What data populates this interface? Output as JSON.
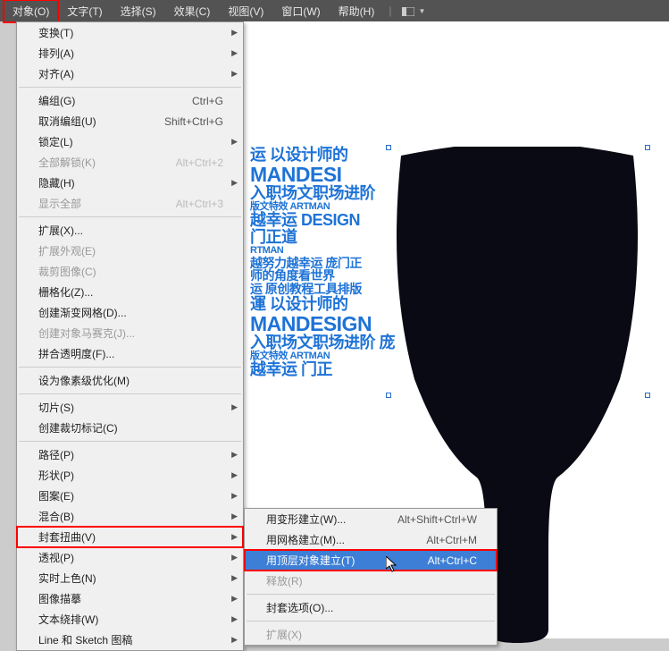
{
  "menubar": {
    "items": [
      "对象(O)",
      "文字(T)",
      "选择(S)",
      "效果(C)",
      "视图(V)",
      "窗口(W)",
      "帮助(H)"
    ],
    "active_index": 0
  },
  "main_menu": [
    {
      "label": "变换(T)",
      "shortcut": "",
      "arrow": true
    },
    {
      "label": "排列(A)",
      "shortcut": "",
      "arrow": true
    },
    {
      "label": "对齐(A)",
      "shortcut": "",
      "arrow": true
    },
    {
      "sep": true
    },
    {
      "label": "编组(G)",
      "shortcut": "Ctrl+G"
    },
    {
      "label": "取消编组(U)",
      "shortcut": "Shift+Ctrl+G"
    },
    {
      "label": "锁定(L)",
      "shortcut": "",
      "arrow": true
    },
    {
      "label": "全部解锁(K)",
      "shortcut": "Alt+Ctrl+2",
      "disabled": true
    },
    {
      "label": "隐藏(H)",
      "shortcut": "",
      "arrow": true
    },
    {
      "label": "显示全部",
      "shortcut": "Alt+Ctrl+3",
      "disabled": true
    },
    {
      "sep": true
    },
    {
      "label": "扩展(X)..."
    },
    {
      "label": "扩展外观(E)",
      "disabled": true
    },
    {
      "label": "裁剪图像(C)",
      "disabled": true
    },
    {
      "label": "栅格化(Z)..."
    },
    {
      "label": "创建渐变网格(D)..."
    },
    {
      "label": "创建对象马赛克(J)...",
      "disabled": true
    },
    {
      "label": "拼合透明度(F)..."
    },
    {
      "sep": true
    },
    {
      "label": "设为像素级优化(M)"
    },
    {
      "sep": true
    },
    {
      "label": "切片(S)",
      "arrow": true
    },
    {
      "label": "创建裁切标记(C)"
    },
    {
      "sep": true
    },
    {
      "label": "路径(P)",
      "arrow": true
    },
    {
      "label": "形状(P)",
      "arrow": true
    },
    {
      "label": "图案(E)",
      "arrow": true
    },
    {
      "label": "混合(B)",
      "arrow": true
    },
    {
      "label": "封套扭曲(V)",
      "arrow": true,
      "highlight": "red"
    },
    {
      "label": "透视(P)",
      "arrow": true
    },
    {
      "label": "实时上色(N)",
      "arrow": true
    },
    {
      "label": "图像描摹",
      "arrow": true
    },
    {
      "label": "文本绕排(W)",
      "arrow": true
    },
    {
      "label": "Line 和 Sketch 图稿",
      "arrow": true
    }
  ],
  "sub_menu": [
    {
      "label": "用变形建立(W)...",
      "shortcut": "Alt+Shift+Ctrl+W"
    },
    {
      "label": "用网格建立(M)...",
      "shortcut": "Alt+Ctrl+M"
    },
    {
      "label": "用顶层对象建立(T)",
      "shortcut": "Alt+Ctrl+C",
      "highlight": "blue"
    },
    {
      "label": "释放(R)",
      "disabled": true
    },
    {
      "sep": true
    },
    {
      "label": "封套选项(O)..."
    },
    {
      "sep": true
    },
    {
      "label": "扩展(X)",
      "disabled": true
    }
  ],
  "canvas": {
    "lines": [
      {
        "cls": "med",
        "text": "运 以设计师的"
      },
      {
        "cls": "big",
        "text": "MANDESI"
      },
      {
        "cls": "med",
        "text": "入职场文职场进阶"
      },
      {
        "cls": "xs",
        "text": "版文特效 ARTMAN"
      },
      {
        "cls": "med",
        "text": "越幸运 DESIGN"
      },
      {
        "cls": "med",
        "text": "门正道"
      },
      {
        "cls": "xs",
        "text": "RTMAN"
      },
      {
        "cls": "sm",
        "text": "越努力越幸运 庞门正"
      },
      {
        "cls": "sm",
        "text": "师的角度看世界"
      },
      {
        "cls": "sm",
        "text": "运 原创教程工具排版"
      },
      {
        "cls": "med",
        "text": "運 以设计师的"
      },
      {
        "cls": "big",
        "text": "MANDESIGN"
      },
      {
        "cls": "med",
        "text": "入职场文职场进阶 庞"
      },
      {
        "cls": "xs",
        "text": "版文特效 ARTMAN"
      },
      {
        "cls": "med",
        "text": "越幸运 门正"
      }
    ]
  }
}
